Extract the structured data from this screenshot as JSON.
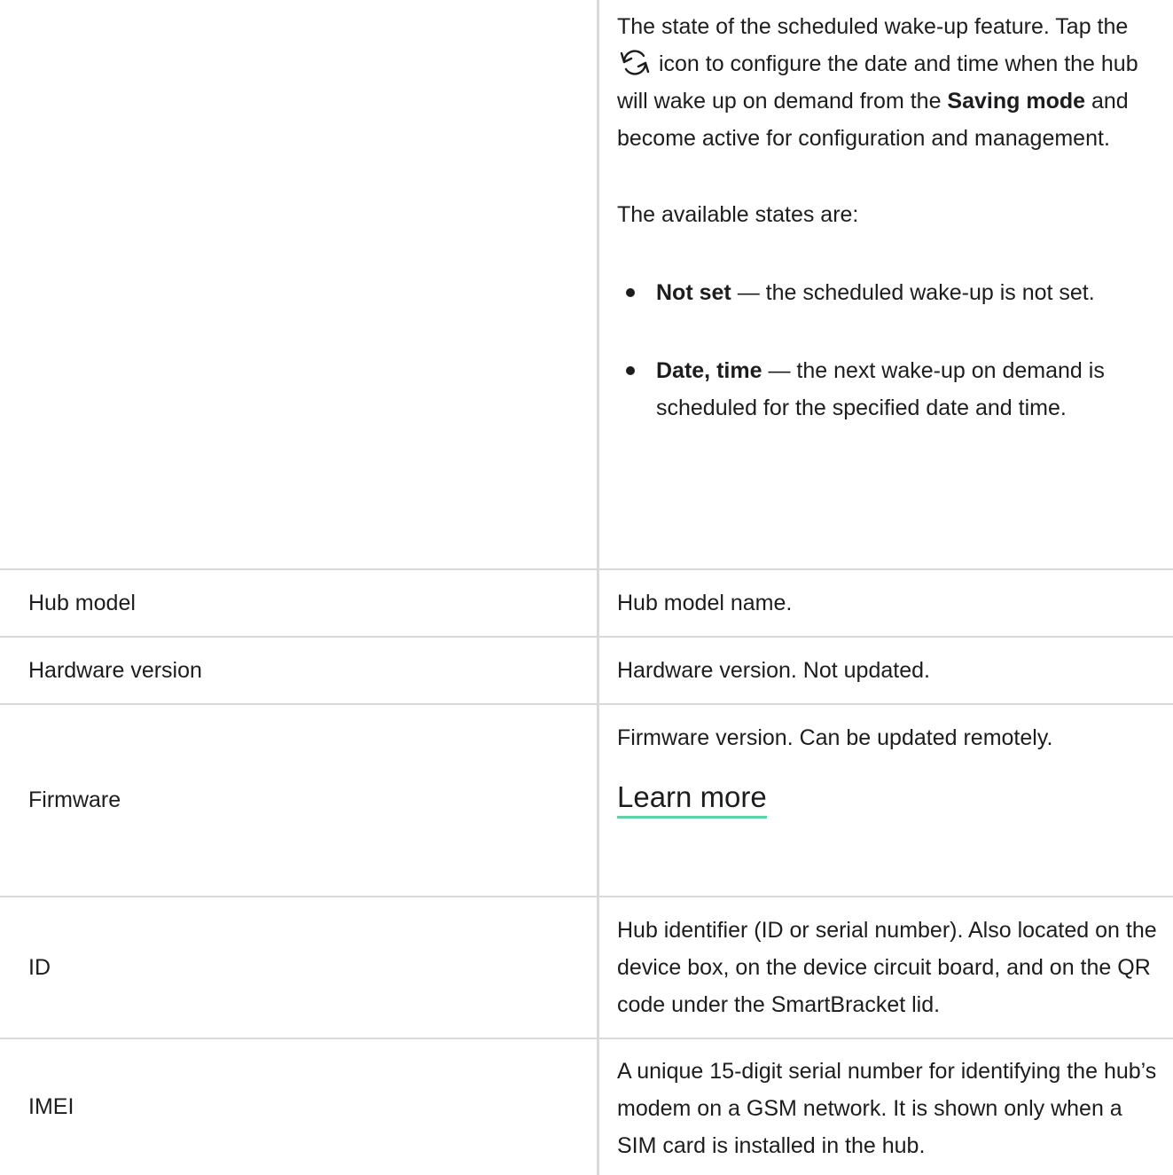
{
  "scheduled_wakeup": {
    "desc_part1": "The state of the scheduled wake-up feature. Tap the",
    "icon": "sync-icon",
    "desc_part2": "icon to configure the date and time when the hub will wake up on demand from the",
    "saving_mode": "Saving mode",
    "desc_part3": "and become active for configuration and management.",
    "states_intro": "The available states are:",
    "states": [
      {
        "name": "Not set",
        "desc": "— the scheduled wake-up is not set."
      },
      {
        "name": "Date, time",
        "desc": "— the next wake-up on demand is scheduled for the specified date and time."
      }
    ]
  },
  "rows": {
    "hub_model": {
      "label": "Hub model",
      "desc": "Hub model name."
    },
    "hardware_version": {
      "label": "Hardware version",
      "desc": "Hardware version. Not updated."
    },
    "firmware": {
      "label": "Firmware",
      "desc": "Firmware version. Can be updated remotely.",
      "link": "Learn more"
    },
    "id": {
      "label": "ID",
      "desc": "Hub identifier (ID or serial number). Also located on the device box, on the device circuit board, and on the QR code under the SmartBracket lid."
    },
    "imei": {
      "label": "IMEI",
      "desc": "A unique 15-digit serial number for identifying the hub’s modem on a GSM network. It is shown only when a SIM card is installed in the hub."
    }
  },
  "colors": {
    "text": "#1d1d1f",
    "border": "#d9d9d9",
    "link_underline": "#5fd3a6"
  }
}
